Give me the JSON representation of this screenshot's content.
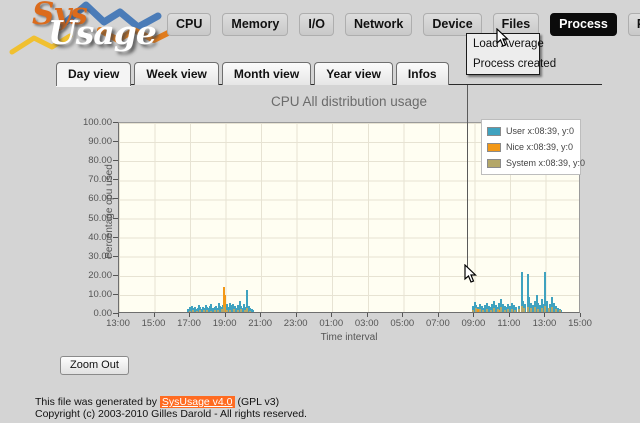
{
  "logo": {
    "sys": "Sys",
    "usage": "Usage"
  },
  "menu": {
    "items": [
      {
        "label": "CPU",
        "active": false
      },
      {
        "label": "Memory",
        "active": false
      },
      {
        "label": "I/O",
        "active": false
      },
      {
        "label": "Network",
        "active": false
      },
      {
        "label": "Device",
        "active": false
      },
      {
        "label": "Files",
        "active": false
      },
      {
        "label": "Process",
        "active": true
      },
      {
        "label": "Plugins",
        "active": false
      }
    ]
  },
  "dropdown": {
    "items": [
      "Load Average",
      "Process created"
    ]
  },
  "tabs": {
    "items": [
      {
        "label": "Day view",
        "active": true
      },
      {
        "label": "Week view",
        "active": false
      },
      {
        "label": "Month view",
        "active": false
      },
      {
        "label": "Year view",
        "active": false
      },
      {
        "label": "Infos",
        "active": false
      }
    ]
  },
  "zoom_out_label": "Zoom Out",
  "footer": {
    "line1_prefix": "This file was generated by ",
    "link": "SysUsage v4.0",
    "line1_suffix": " (GPL v3)",
    "line2": "Copyright (c) 2003-2010 Gilles Darold - All rights reserved."
  },
  "chart_data": {
    "type": "bar",
    "title": "CPU All distribution usage",
    "xlabel": "Time interval",
    "ylabel": "Percentage cpu used",
    "ylim": [
      0,
      100
    ],
    "x_ticks": [
      "13:00",
      "15:00",
      "17:00",
      "19:00",
      "21:00",
      "23:00",
      "01:00",
      "03:00",
      "05:00",
      "07:00",
      "09:00",
      "11:00",
      "13:00",
      "15:00"
    ],
    "y_ticks": [
      "100.00",
      "90.00",
      "80.00",
      "70.00",
      "60.00",
      "50.00",
      "40.00",
      "30.00",
      "20.00",
      "10.00",
      "0.00"
    ],
    "x_range_hours": [
      0,
      26
    ],
    "grid": true,
    "legend_position": "top-right",
    "crosshair": {
      "x_hours": 19.65,
      "label": "x:08:39, y:0"
    },
    "legend": [
      {
        "name": "User",
        "label": "User x:08:39, y:0",
        "color": "#3fa2bf"
      },
      {
        "name": "Nice",
        "label": "Nice x:08:39, y:0",
        "color": "#f29817"
      },
      {
        "name": "System",
        "label": "System x:08:39, y:0",
        "color": "#b4a768"
      }
    ],
    "series": [
      {
        "name": "User",
        "color": "#3fa2bf",
        "points": [
          [
            3.9,
            1.5
          ],
          [
            4.0,
            2.5
          ],
          [
            4.07,
            1.8
          ],
          [
            4.15,
            3.2
          ],
          [
            4.22,
            2.0
          ],
          [
            4.3,
            2.8
          ],
          [
            4.37,
            1.6
          ],
          [
            4.45,
            2.2
          ],
          [
            4.52,
            3.5
          ],
          [
            4.6,
            2.4
          ],
          [
            4.67,
            1.8
          ],
          [
            4.75,
            2.9
          ],
          [
            4.82,
            2.1
          ],
          [
            4.9,
            3.8
          ],
          [
            4.97,
            2.6
          ],
          [
            5.05,
            2.0
          ],
          [
            5.12,
            3.0
          ],
          [
            5.2,
            4.2
          ],
          [
            5.27,
            2.3
          ],
          [
            5.35,
            1.9
          ],
          [
            5.42,
            2.7
          ],
          [
            5.5,
            3.4
          ],
          [
            5.57,
            2.2
          ],
          [
            5.65,
            4.8
          ],
          [
            5.72,
            3.0
          ],
          [
            5.8,
            2.5
          ],
          [
            5.87,
            3.6
          ],
          [
            5.95,
            5.5
          ],
          [
            6.02,
            3.2
          ],
          [
            6.1,
            4.0
          ],
          [
            6.17,
            2.8
          ],
          [
            6.25,
            5.0
          ],
          [
            6.32,
            3.5
          ],
          [
            6.4,
            2.6
          ],
          [
            6.47,
            4.4
          ],
          [
            6.55,
            3.0
          ],
          [
            6.62,
            2.2
          ],
          [
            6.7,
            3.8
          ],
          [
            6.77,
            2.4
          ],
          [
            6.85,
            6.0
          ],
          [
            6.92,
            3.3
          ],
          [
            7.0,
            2.0
          ],
          [
            7.07,
            4.5
          ],
          [
            7.15,
            2.8
          ],
          [
            7.25,
            11.5
          ],
          [
            7.33,
            3.0
          ],
          [
            7.42,
            2.2
          ],
          [
            7.5,
            1.6
          ],
          [
            7.6,
            1.2
          ],
          [
            20.0,
            3.0
          ],
          [
            20.1,
            5.5
          ],
          [
            20.2,
            3.5
          ],
          [
            20.3,
            2.5
          ],
          [
            20.4,
            4.5
          ],
          [
            20.5,
            3.0
          ],
          [
            20.6,
            2.0
          ],
          [
            20.7,
            3.5
          ],
          [
            20.8,
            5.0
          ],
          [
            20.9,
            3.0
          ],
          [
            21.0,
            2.5
          ],
          [
            21.1,
            4.0
          ],
          [
            21.2,
            6.0
          ],
          [
            21.3,
            3.5
          ],
          [
            21.4,
            2.5
          ],
          [
            21.5,
            5.0
          ],
          [
            21.6,
            7.0
          ],
          [
            21.7,
            4.0
          ],
          [
            21.8,
            3.0
          ],
          [
            21.9,
            2.5
          ],
          [
            22.0,
            4.0
          ],
          [
            22.1,
            3.0
          ],
          [
            22.2,
            5.0
          ],
          [
            22.3,
            3.5
          ],
          [
            22.45,
            2.5
          ],
          [
            22.6,
            3.0
          ],
          [
            22.75,
            21.0
          ],
          [
            22.85,
            6.0
          ],
          [
            22.95,
            4.0
          ],
          [
            23.1,
            20.0
          ],
          [
            23.2,
            8.0
          ],
          [
            23.3,
            5.0
          ],
          [
            23.4,
            3.5
          ],
          [
            23.5,
            6.0
          ],
          [
            23.6,
            9.0
          ],
          [
            23.7,
            5.0
          ],
          [
            23.8,
            3.5
          ],
          [
            23.9,
            7.0
          ],
          [
            24.0,
            4.0
          ],
          [
            24.1,
            21.0
          ],
          [
            24.2,
            6.0
          ],
          [
            24.35,
            4.0
          ],
          [
            24.5,
            8.0
          ],
          [
            24.6,
            5.0
          ],
          [
            24.7,
            3.0
          ],
          [
            24.8,
            2.0
          ],
          [
            24.9,
            1.5
          ],
          [
            25.0,
            1.0
          ]
        ]
      },
      {
        "name": "Nice",
        "color": "#f29817",
        "points": [
          [
            5.95,
            13.0
          ],
          [
            6.0,
            9.0
          ],
          [
            20.3,
            1.5
          ],
          [
            21.5,
            1.2
          ],
          [
            22.75,
            2.0
          ],
          [
            23.1,
            1.5
          ],
          [
            24.1,
            2.0
          ],
          [
            24.5,
            1.5
          ]
        ]
      },
      {
        "name": "System",
        "color": "#b4a768",
        "points": [
          [
            4.0,
            0.8
          ],
          [
            4.2,
            1.0
          ],
          [
            4.4,
            0.7
          ],
          [
            4.6,
            1.2
          ],
          [
            4.8,
            0.9
          ],
          [
            5.0,
            1.1
          ],
          [
            5.2,
            0.8
          ],
          [
            5.4,
            1.3
          ],
          [
            5.6,
            1.0
          ],
          [
            5.8,
            1.5
          ],
          [
            5.95,
            2.5
          ],
          [
            6.1,
            1.2
          ],
          [
            6.3,
            1.0
          ],
          [
            6.5,
            1.4
          ],
          [
            6.7,
            0.9
          ],
          [
            6.9,
            1.6
          ],
          [
            7.1,
            1.0
          ],
          [
            7.25,
            2.0
          ],
          [
            7.4,
            0.8
          ],
          [
            20.0,
            1.2
          ],
          [
            20.2,
            2.0
          ],
          [
            20.4,
            1.5
          ],
          [
            20.6,
            1.0
          ],
          [
            20.8,
            1.8
          ],
          [
            21.0,
            1.2
          ],
          [
            21.2,
            2.2
          ],
          [
            21.4,
            1.5
          ],
          [
            21.6,
            2.5
          ],
          [
            21.8,
            1.3
          ],
          [
            22.0,
            1.8
          ],
          [
            22.2,
            1.4
          ],
          [
            22.4,
            1.0
          ],
          [
            22.6,
            1.5
          ],
          [
            22.75,
            3.0
          ],
          [
            22.9,
            2.0
          ],
          [
            23.1,
            2.8
          ],
          [
            23.3,
            2.0
          ],
          [
            23.5,
            2.4
          ],
          [
            23.7,
            1.8
          ],
          [
            23.9,
            2.2
          ],
          [
            24.1,
            3.0
          ],
          [
            24.3,
            2.0
          ],
          [
            24.5,
            2.6
          ],
          [
            24.7,
            1.5
          ],
          [
            24.9,
            1.0
          ]
        ]
      }
    ]
  }
}
